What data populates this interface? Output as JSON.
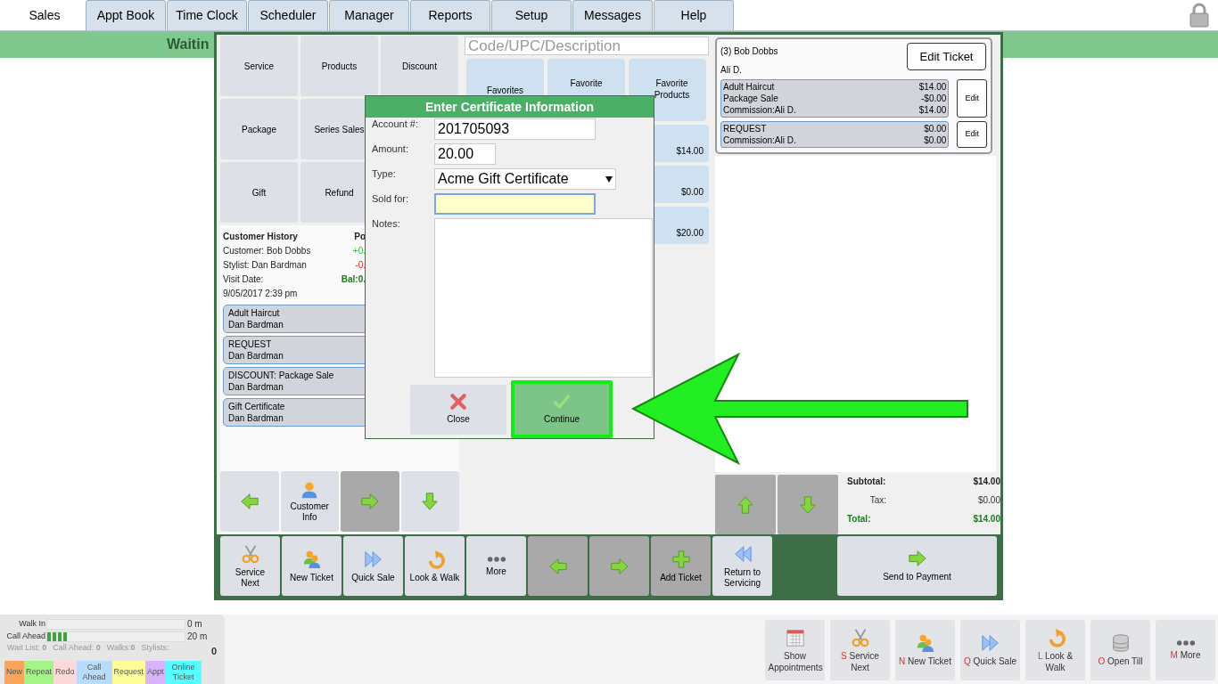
{
  "tabs": [
    {
      "label": "Sales",
      "selected": true
    },
    {
      "label": "Appt Book",
      "selected": false
    },
    {
      "label": "Time Clock",
      "selected": false
    },
    {
      "label": "Scheduler",
      "selected": false
    },
    {
      "label": "Manager",
      "selected": false
    },
    {
      "label": "Reports",
      "selected": false
    },
    {
      "label": "Setup",
      "selected": false
    },
    {
      "label": "Messages",
      "selected": false
    },
    {
      "label": "Help",
      "selected": false
    }
  ],
  "waiting_bar": {
    "text": "Waitin"
  },
  "category_buttons": [
    {
      "label": "Service"
    },
    {
      "label": "Products"
    },
    {
      "label": "Discount"
    },
    {
      "label": "Package"
    },
    {
      "label": "Series Sales"
    },
    {
      "label": "Gift"
    },
    {
      "label": "Refund"
    }
  ],
  "customer_history": {
    "title": "Customer History",
    "lines": [
      "Customer: Bob Dobbs",
      "Stylist: Dan Bardman",
      "Visit Date:",
      "9/05/2017 2:39 pm"
    ],
    "points_header": "Po",
    "points": [
      {
        "text": "+0.",
        "kind": "plus"
      },
      {
        "text": "-0.",
        "kind": "minus"
      },
      {
        "text": "Bal:0.",
        "kind": "balance"
      }
    ]
  },
  "history_items": [
    {
      "title": "Adult Haircut",
      "stylist": "Dan Bardman"
    },
    {
      "title": "REQUEST",
      "stylist": "Dan Bardman"
    },
    {
      "title": "DISCOUNT: Package Sale",
      "stylist": "Dan Bardman"
    },
    {
      "title": "Gift Certificate",
      "stylist": "Dan Bardman"
    }
  ],
  "nav_buttons": [
    {
      "kind": "back",
      "highlighted": false
    },
    {
      "kind": "customer",
      "label": "Customer Info",
      "highlighted": false
    },
    {
      "kind": "forward",
      "highlighted": true
    },
    {
      "kind": "down",
      "highlighted": false
    }
  ],
  "search": {
    "placeholder": "Code/UPC/Description"
  },
  "favorites": [
    {
      "label": "Favorites"
    },
    {
      "label": "Favorite"
    },
    {
      "label": "Favorite Products"
    }
  ],
  "price_buttons": [
    {
      "price": "$14.00"
    },
    {
      "price": "$0.00"
    },
    {
      "price": "$20.00"
    }
  ],
  "ticket": {
    "title": "(3) Bob Dobbs",
    "stylist": "Ali D.",
    "edit_ticket": "Edit Ticket",
    "lines": [
      {
        "rows": [
          {
            "label": "Adult Haircut",
            "amount": "$14.00"
          },
          {
            "label": "Package Sale",
            "amount": "-$0.00"
          },
          {
            "label": "Commission:Ali D.",
            "amount": "$14.00"
          }
        ],
        "edit": "Edit"
      },
      {
        "rows": [
          {
            "label": "REQUEST",
            "amount": "$0.00"
          },
          {
            "label": "Commission:Ali D.",
            "amount": "$0.00"
          }
        ],
        "edit": "Edit"
      }
    ]
  },
  "scroll_buttons": [
    {
      "kind": "up"
    },
    {
      "kind": "down"
    }
  ],
  "totals": [
    {
      "label": "Subtotal:",
      "value": "$14.00",
      "kind": "subtotal"
    },
    {
      "label": "Tax:",
      "value": "$0.00",
      "kind": "tax"
    },
    {
      "label": "Total:",
      "value": "$14.00",
      "kind": "total"
    }
  ],
  "toolbar": [
    {
      "label": "Service Next",
      "kind": "service",
      "highlighted": false
    },
    {
      "label": "New Ticket",
      "kind": "ticket",
      "highlighted": false
    },
    {
      "label": "Quick Sale",
      "kind": "quick",
      "highlighted": false
    },
    {
      "label": "Look & Walk",
      "kind": "walk",
      "highlighted": false
    },
    {
      "label": "More",
      "kind": "more",
      "highlighted": false
    },
    {
      "kind": "back",
      "highlighted": true
    },
    {
      "kind": "forward",
      "highlighted": true
    },
    {
      "label": "Add Ticket",
      "kind": "add",
      "highlighted": true
    },
    {
      "label": "Return to Servicing",
      "kind": "return",
      "highlighted": false
    }
  ],
  "send_button": {
    "label": "Send to Payment"
  },
  "dialog": {
    "title": "Enter Certificate Information",
    "fields": [
      {
        "label": "Account #:",
        "value": "201705093",
        "kind": "text",
        "focused": false
      },
      {
        "label": "Amount:",
        "value": "20.00",
        "kind": "short",
        "focused": false
      },
      {
        "label": "Type:",
        "value": "Acme Gift Certificate",
        "kind": "select",
        "focused": false
      },
      {
        "label": "Sold for:",
        "kind": "text",
        "focused": true
      },
      {
        "label": "Notes:",
        "kind": "textarea",
        "focused": false
      }
    ],
    "buttons": [
      {
        "label": "Close",
        "kind": "close",
        "highlighted": false
      },
      {
        "label": "Continue",
        "kind": "continue",
        "highlighted": true
      }
    ]
  },
  "queue": {
    "rows": [
      {
        "label": "Walk In",
        "level": 0,
        "reading": "0 m"
      },
      {
        "label": "Call Ahead",
        "level": 0.14,
        "reading": "20 m"
      }
    ],
    "stats": [
      "Wait List: **0**",
      "Call Ahead: **0**",
      "Walks:**0**",
      "Stylists:"
    ],
    "stylists_count": "0",
    "legend": [
      {
        "label": "New",
        "color": "#f9a55c"
      },
      {
        "label": "Repeat",
        "color": "#a3f586"
      },
      {
        "label": "Redo",
        "color": "#ffd9d9"
      },
      {
        "label": "Call Ahead",
        "color": "#b8dcff"
      },
      {
        "label": "Request",
        "color": "#ffff99"
      },
      {
        "label": "Appt",
        "color": "#d9b3ff"
      },
      {
        "label": "Online Ticket",
        "color": "#55ffff"
      }
    ]
  },
  "action_bar": [
    {
      "label": "Show Appointments",
      "kind": "appointments"
    },
    {
      "key": "S",
      "label": "Service Next",
      "kind": "service"
    },
    {
      "key": "N",
      "label": "New Ticket",
      "kind": "ticket"
    },
    {
      "key": "Q",
      "label": "Quick Sale",
      "kind": "quick"
    },
    {
      "key": "L",
      "label": "Look & Walk",
      "kind": "walk"
    },
    {
      "key": "O",
      "label": "Open Till",
      "kind": "till"
    },
    {
      "key": "M",
      "label": "More",
      "kind": "more"
    }
  ]
}
